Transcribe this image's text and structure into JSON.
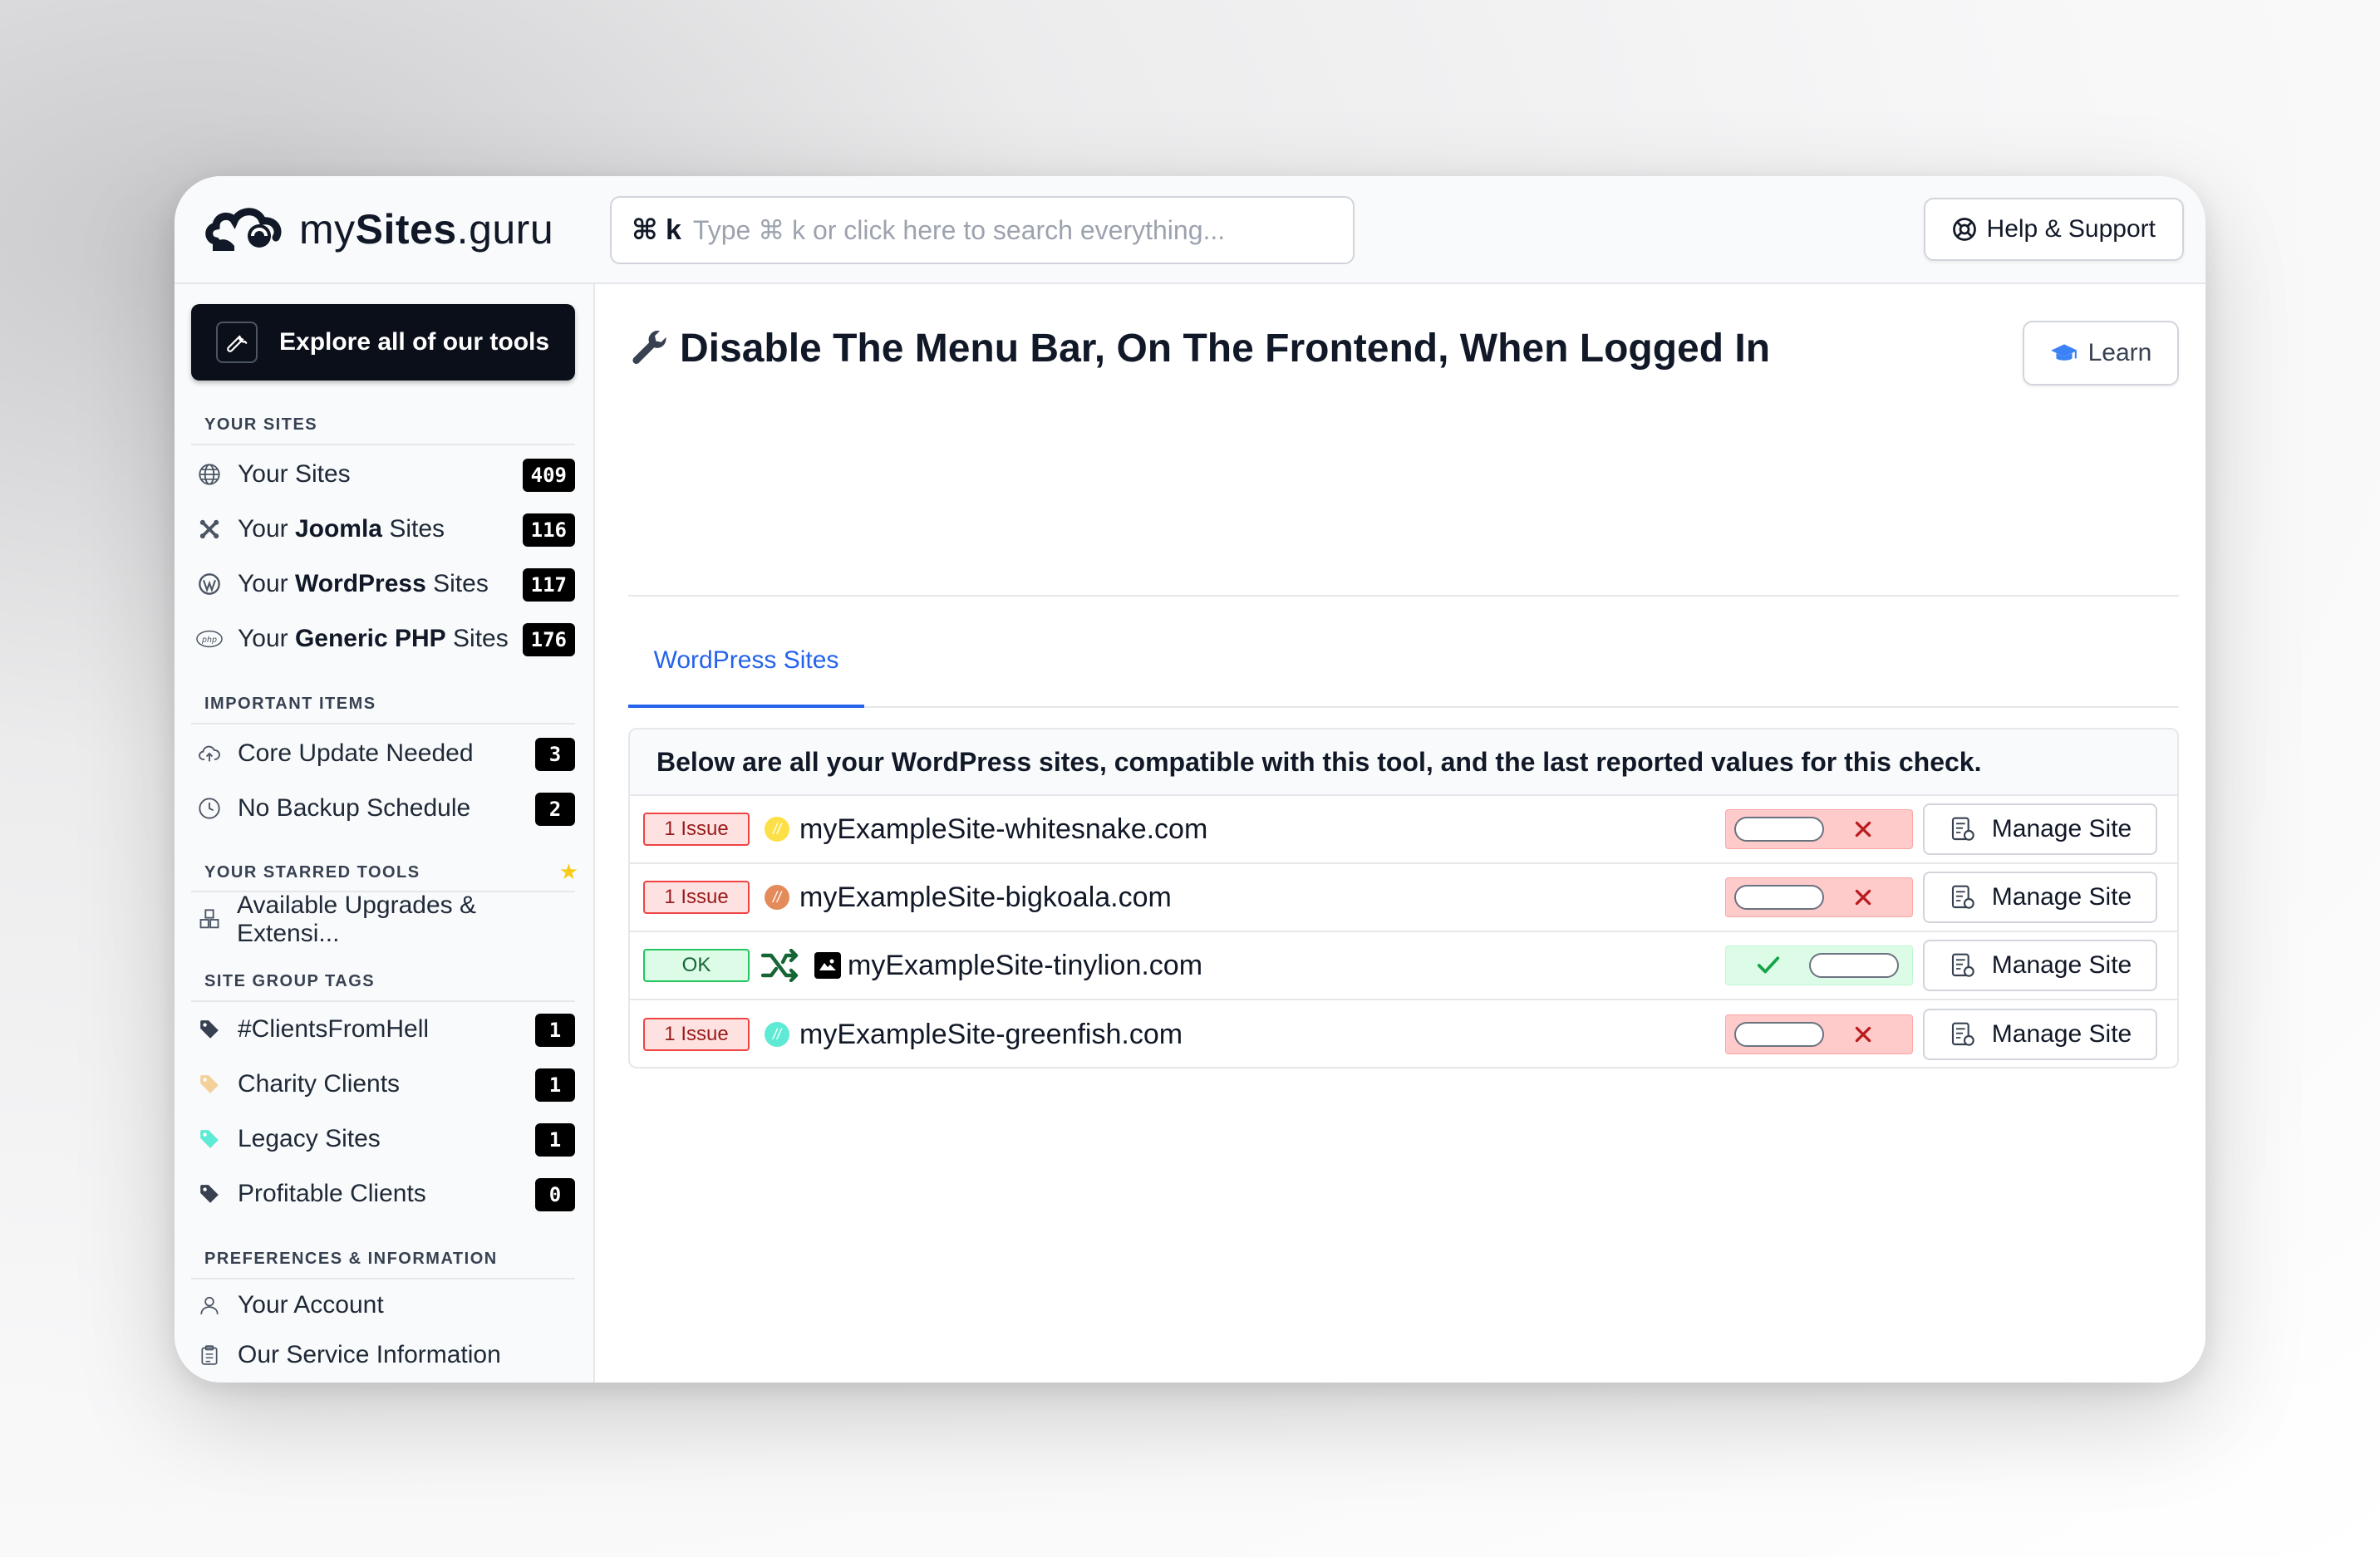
{
  "app": {
    "logo_text_pre": "my",
    "logo_text_bold": "Sites",
    "logo_text_post": ".guru",
    "search_kbd": "⌘ k",
    "search_placeholder": "Type ⌘ k or click here to search everything...",
    "help_label": "Help & Support"
  },
  "sidebar": {
    "explore_label": "Explore all of our tools",
    "sections": {
      "your_sites": "YOUR SITES",
      "important": "IMPORTANT ITEMS",
      "starred": "YOUR STARRED TOOLS",
      "tags": "SITE GROUP TAGS",
      "prefs": "PREFERENCES & INFORMATION"
    },
    "sites": [
      {
        "pre": "Your Sites",
        "bold": "",
        "post": "",
        "count": "409",
        "icon": "globe-icon"
      },
      {
        "pre": "Your ",
        "bold": "Joomla",
        "post": " Sites",
        "count": "116",
        "icon": "joomla-icon"
      },
      {
        "pre": "Your ",
        "bold": "WordPress",
        "post": " Sites",
        "count": "117",
        "icon": "wordpress-icon"
      },
      {
        "pre": "Your ",
        "bold": "Generic PHP",
        "post": " Sites",
        "count": "176",
        "icon": "php-icon"
      }
    ],
    "important": [
      {
        "label": "Core Update Needed",
        "count": "3",
        "icon": "cloud-upload-icon"
      },
      {
        "label": "No Backup Schedule",
        "count": "2",
        "icon": "clock-icon"
      }
    ],
    "starred": [
      {
        "label": "Available Upgrades & Extensi...",
        "icon": "cubes-icon"
      }
    ],
    "tags": [
      {
        "label": "#ClientsFromHell",
        "count": "1",
        "color": "#374151"
      },
      {
        "label": "Charity Clients",
        "count": "1",
        "color": "#f4d09b"
      },
      {
        "label": "Legacy Sites",
        "count": "1",
        "color": "#5eead4"
      },
      {
        "label": "Profitable Clients",
        "count": "0",
        "color": "#374151"
      }
    ],
    "prefs": [
      {
        "label": "Your Account",
        "icon": "user-icon"
      },
      {
        "label": "Our Service Information",
        "icon": "clipboard-icon"
      }
    ]
  },
  "main": {
    "title": "Disable The Menu Bar, On The Frontend, When Logged In",
    "learn_label": "Learn",
    "tab_label": "WordPress Sites",
    "panel_heading": "Below are all your WordPress sites, compatible with this tool, and the last reported values for this check.",
    "manage_label": "Manage Site",
    "rows": [
      {
        "status": "1 Issue",
        "site": "myExampleSite-whitesnake.com",
        "state": "off",
        "fav_color": "#fde047"
      },
      {
        "status": "1 Issue",
        "site": "myExampleSite-bigkoala.com",
        "state": "off",
        "fav_color": "#e38b5b"
      },
      {
        "status": "OK",
        "site": "myExampleSite-tinylion.com",
        "state": "on",
        "fav_color": "#000000"
      },
      {
        "status": "1 Issue",
        "site": "myExampleSite-greenfish.com",
        "state": "off",
        "fav_color": "#5eead4"
      }
    ]
  },
  "colors": {
    "accent": "#2563eb",
    "issue_bg": "#fee2e2",
    "issue_border": "#ef4444",
    "ok_bg": "#dcfce7",
    "ok_border": "#22c55e",
    "badge_bg": "#000000"
  }
}
